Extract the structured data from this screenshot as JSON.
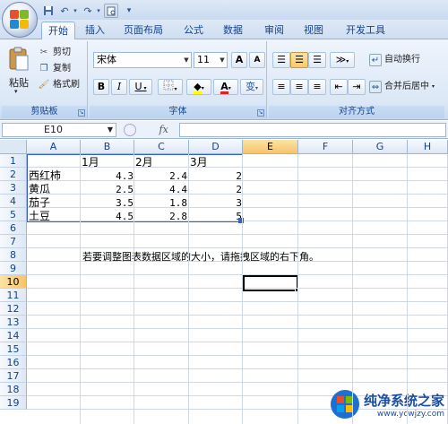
{
  "colors": {
    "accent": "#15428b",
    "selection": "#f7c46a"
  },
  "quick_access": {
    "save_icon": "save-icon",
    "undo_icon": "undo-icon",
    "redo_icon": "redo-icon",
    "print_icon": "print-preview-icon",
    "customize": "▾"
  },
  "tabs": [
    {
      "label": "开始",
      "active": true
    },
    {
      "label": "插入"
    },
    {
      "label": "页面布局"
    },
    {
      "label": "公式"
    },
    {
      "label": "数据"
    },
    {
      "label": "审阅"
    },
    {
      "label": "视图"
    },
    {
      "label": "开发工具"
    }
  ],
  "ribbon": {
    "clipboard": {
      "label": "剪贴板",
      "paste": "粘贴",
      "cut": "剪切",
      "copy": "复制",
      "format_painter": "格式刷"
    },
    "font": {
      "label": "字体",
      "font_name": "宋体",
      "font_size": "11",
      "grow": "A",
      "shrink": "A",
      "bold": "B",
      "italic": "I",
      "underline": "U",
      "font_color": "A",
      "phonetic": "变"
    },
    "alignment": {
      "label": "对齐方式",
      "wrap_text": "自动换行",
      "merge_center": "合并后居中"
    }
  },
  "formula_bar": {
    "name_box": "E10",
    "fx": "fx",
    "value": ""
  },
  "columns": [
    "A",
    "B",
    "C",
    "D",
    "E",
    "F",
    "G",
    "H"
  ],
  "rows": [
    "1",
    "2",
    "3",
    "4",
    "5",
    "6",
    "7",
    "8",
    "9",
    "10",
    "11",
    "12",
    "13",
    "14",
    "15",
    "16",
    "17",
    "18",
    "19"
  ],
  "selected_cell": {
    "col": "E",
    "row": "10"
  },
  "sheet": {
    "header": [
      "",
      "1月",
      "2月",
      "3月"
    ],
    "data": [
      {
        "name": "西红柿",
        "v1": "4.3",
        "v2": "2.4",
        "v3": "2"
      },
      {
        "name": "黄瓜",
        "v1": "2.5",
        "v2": "4.4",
        "v3": "2"
      },
      {
        "name": "茄子",
        "v1": "3.5",
        "v2": "1.8",
        "v3": "3"
      },
      {
        "name": "土豆",
        "v1": "4.5",
        "v2": "2.8",
        "v3": "5"
      }
    ],
    "note": "若要调整图表数据区域的大小，请拖拽区域的右下角。"
  },
  "watermark": {
    "title": "纯净系统之家",
    "url": "www.ycwjzy.com"
  }
}
